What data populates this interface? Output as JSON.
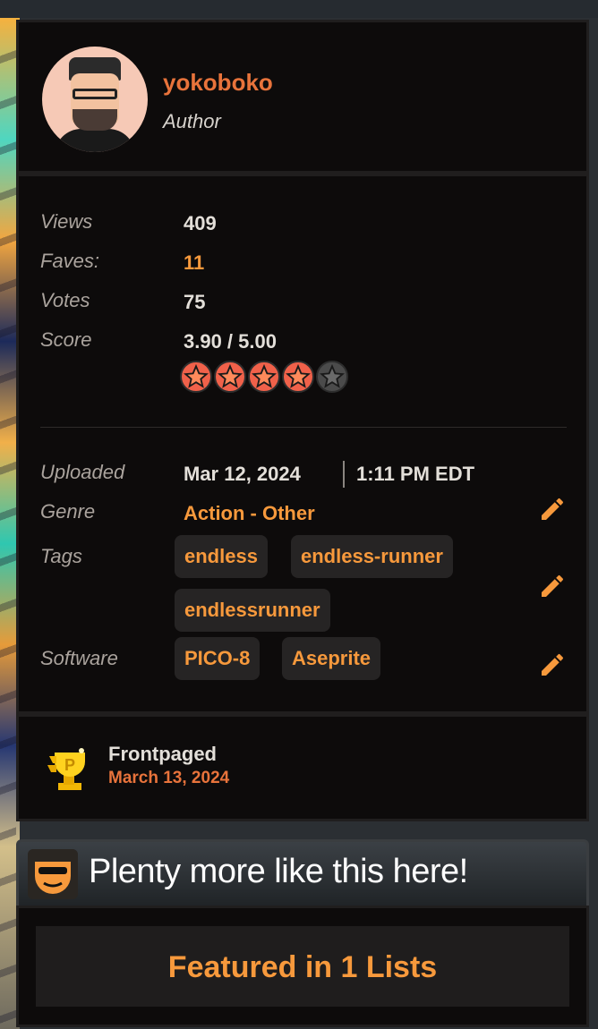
{
  "author": {
    "name": "yokoboko",
    "role": "Author"
  },
  "stats": {
    "views_label": "Views",
    "views": "409",
    "faves_label": "Faves:",
    "faves": "11",
    "votes_label": "Votes",
    "votes": "75",
    "score_label": "Score",
    "score": "3.90 / 5.00",
    "stars_filled": 4,
    "stars_total": 5
  },
  "details": {
    "uploaded_label": "Uploaded",
    "uploaded_date": "Mar 12, 2024",
    "uploaded_time": "1:11 PM EDT",
    "genre_label": "Genre",
    "genre": "Action - Other",
    "tags_label": "Tags",
    "tags": [
      "endless",
      "endless-runner",
      "endlessrunner"
    ],
    "software_label": "Software",
    "software": [
      "PICO-8",
      "Aseprite"
    ]
  },
  "frontpaged": {
    "title": "Frontpaged",
    "date": "March 13, 2024"
  },
  "more": {
    "title": "Plenty more like this here!",
    "featured_label": "Featured in 1 Lists"
  },
  "colors": {
    "accent_orange": "#f7993c",
    "author_orange": "#e8733b",
    "panel_bg": "#0d0b0b"
  }
}
